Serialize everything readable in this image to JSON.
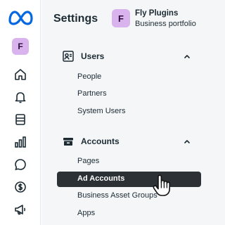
{
  "sidebar_rail": {
    "logo": "meta-logo",
    "avatar_letter": "F",
    "icons": [
      "home-icon",
      "bell-icon",
      "pages-icon",
      "analytics-icon",
      "chat-icon",
      "dollar-icon",
      "megaphone-icon"
    ]
  },
  "header": {
    "title": "Settings",
    "business_avatar_letter": "F",
    "business_name": "Fly Plugins",
    "business_subtitle": "Business portfolio"
  },
  "sections": [
    {
      "label": "Users",
      "icon": "users-icon",
      "expanded": true,
      "items": [
        "People",
        "Partners",
        "System Users"
      ]
    },
    {
      "label": "Accounts",
      "icon": "accounts-icon",
      "expanded": true,
      "items": [
        "Pages",
        "Ad Accounts",
        "Business Asset Groups",
        "Apps"
      ]
    }
  ],
  "active_item": "Ad Accounts",
  "colors": {
    "panel_bg": "#f4f6f8",
    "avatar_bg": "#d9b3ee",
    "active_bg": "#2b3135",
    "text": "#1c2b33",
    "meta_blue": "#0668e1"
  }
}
